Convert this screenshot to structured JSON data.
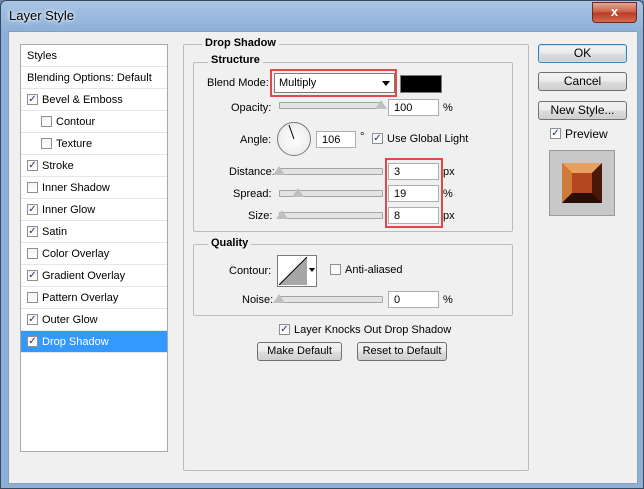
{
  "window": {
    "title": "Layer Style",
    "close_glyph": "x"
  },
  "left_panel": {
    "items": [
      {
        "label": "Styles",
        "has_checkbox": false,
        "checked": false,
        "selected": false
      },
      {
        "label": "Blending Options: Default",
        "has_checkbox": false,
        "checked": false,
        "selected": false
      },
      {
        "label": "Bevel & Emboss",
        "has_checkbox": true,
        "checked": true,
        "selected": false
      },
      {
        "label": "Contour",
        "has_checkbox": true,
        "checked": false,
        "selected": false,
        "indent": true
      },
      {
        "label": "Texture",
        "has_checkbox": true,
        "checked": false,
        "selected": false,
        "indent": true
      },
      {
        "label": "Stroke",
        "has_checkbox": true,
        "checked": true,
        "selected": false
      },
      {
        "label": "Inner Shadow",
        "has_checkbox": true,
        "checked": false,
        "selected": false
      },
      {
        "label": "Inner Glow",
        "has_checkbox": true,
        "checked": true,
        "selected": false
      },
      {
        "label": "Satin",
        "has_checkbox": true,
        "checked": true,
        "selected": false
      },
      {
        "label": "Color Overlay",
        "has_checkbox": true,
        "checked": false,
        "selected": false
      },
      {
        "label": "Gradient Overlay",
        "has_checkbox": true,
        "checked": true,
        "selected": false
      },
      {
        "label": "Pattern Overlay",
        "has_checkbox": true,
        "checked": false,
        "selected": false
      },
      {
        "label": "Outer Glow",
        "has_checkbox": true,
        "checked": true,
        "selected": false
      },
      {
        "label": "Drop Shadow",
        "has_checkbox": true,
        "checked": true,
        "selected": true
      }
    ]
  },
  "drop_shadow": {
    "group_title": "Drop Shadow",
    "structure": {
      "title": "Structure",
      "blend_mode_label": "Blend Mode:",
      "blend_mode_value": "Multiply",
      "shadow_color": "#000000",
      "opacity_label": "Opacity:",
      "opacity_value": "100",
      "opacity_unit": "%",
      "opacity_level": 1.0,
      "angle_label": "Angle:",
      "angle_value": "106",
      "angle_unit": "°",
      "use_global_light_label": "Use Global Light",
      "use_global_light_checked": true,
      "distance_label": "Distance:",
      "distance_value": "3",
      "distance_unit": "px",
      "distance_level": 0.0,
      "spread_label": "Spread:",
      "spread_value": "19",
      "spread_unit": "%",
      "spread_level": 0.19,
      "size_label": "Size:",
      "size_value": "8",
      "size_unit": "px",
      "size_level": 0.03
    },
    "quality": {
      "title": "Quality",
      "contour_label": "Contour:",
      "anti_aliased_label": "Anti-aliased",
      "anti_aliased_checked": false,
      "noise_label": "Noise:",
      "noise_value": "0",
      "noise_unit": "%",
      "noise_level": 0.0
    },
    "knocks_out_label": "Layer Knocks Out Drop Shadow",
    "knocks_out_checked": true,
    "make_default_label": "Make Default",
    "reset_default_label": "Reset to Default"
  },
  "right_panel": {
    "ok_label": "OK",
    "cancel_label": "Cancel",
    "new_style_label": "New Style...",
    "preview_label": "Preview",
    "preview_checked": true
  },
  "colors": {
    "selection": "#3399ff",
    "highlight_box": "#e0484a"
  }
}
